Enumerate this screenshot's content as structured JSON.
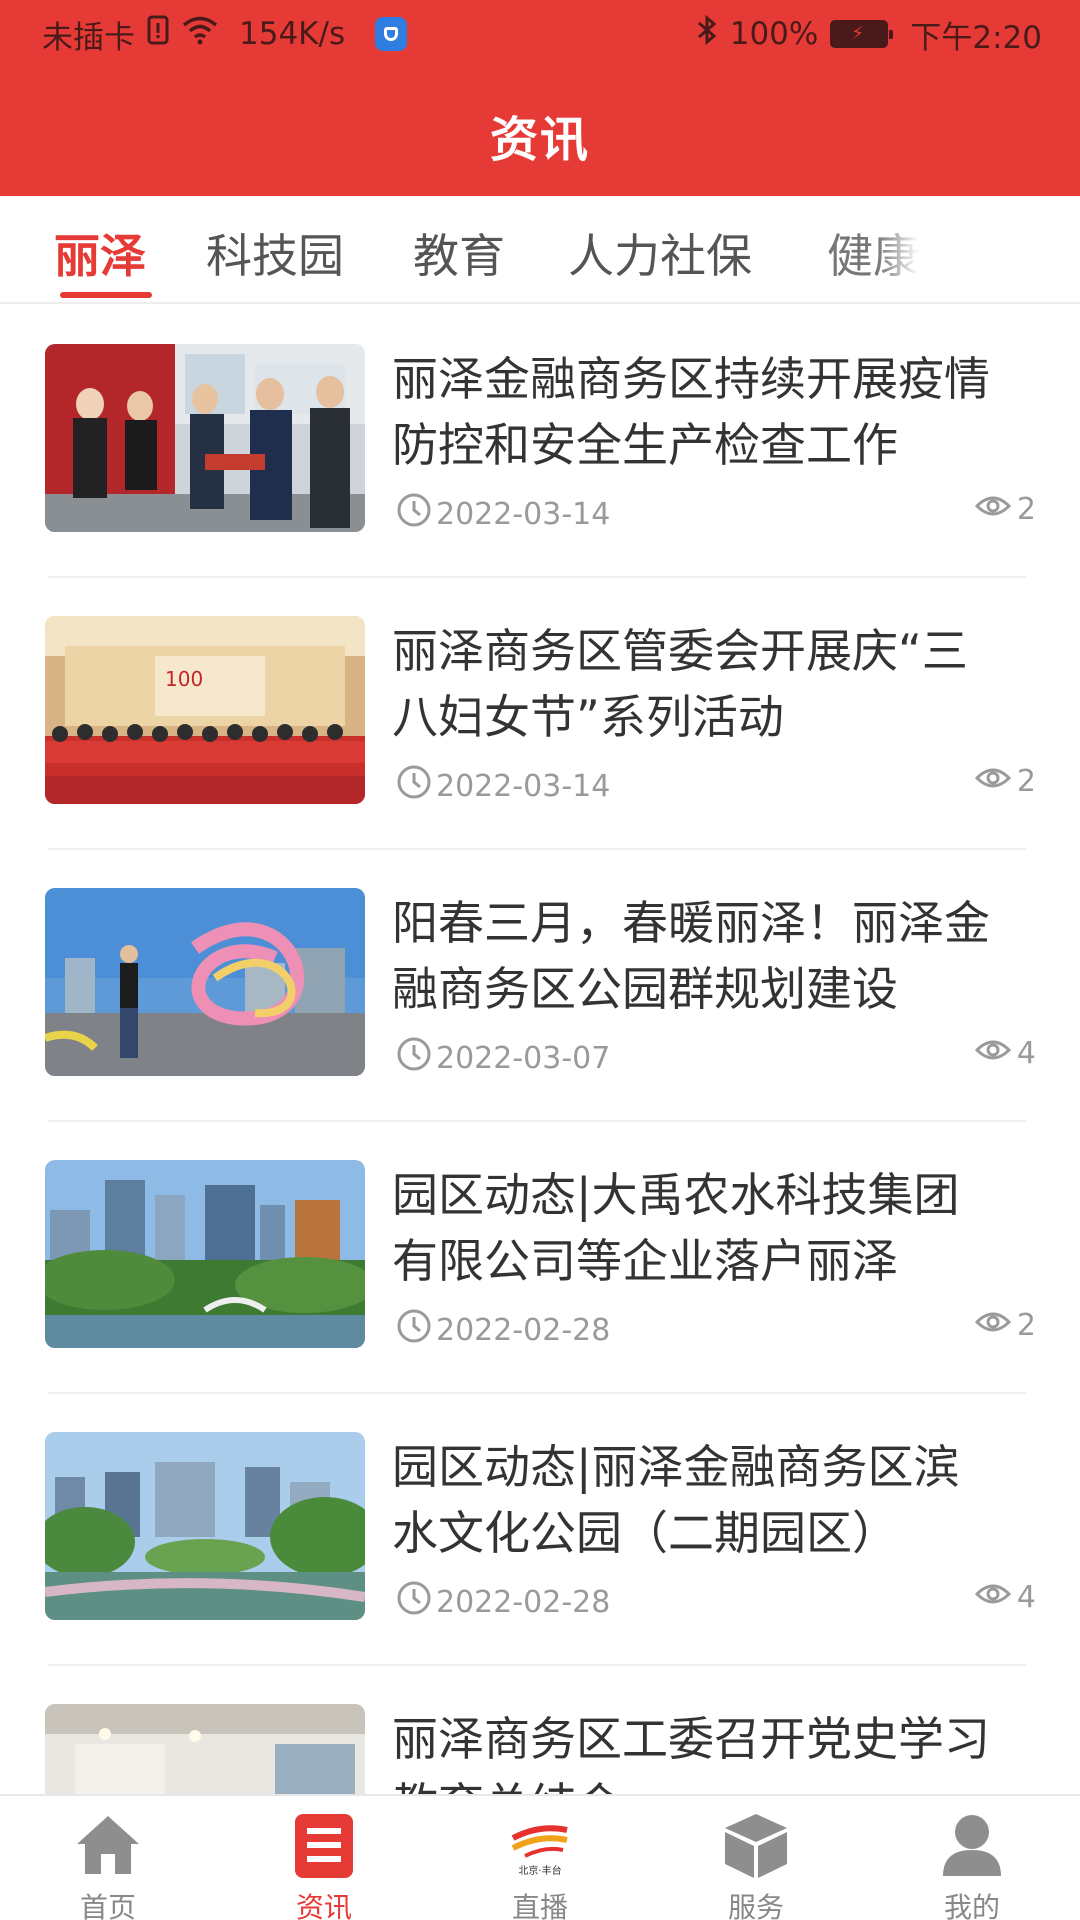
{
  "status_bar": {
    "carrier": "未插卡",
    "speed": "154K/s",
    "battery": "100%",
    "time": "下午2:20"
  },
  "header": {
    "title": "资讯"
  },
  "tabs": [
    {
      "label": "丽泽",
      "active": true
    },
    {
      "label": "科技园",
      "active": false
    },
    {
      "label": "教育",
      "active": false
    },
    {
      "label": "人力社保",
      "active": false
    },
    {
      "label": "健康",
      "active": false
    }
  ],
  "news": [
    {
      "title": "丽泽金融商务区持续开展疫情防控和安全生产检查工作",
      "date": "2022-03-14",
      "views": "2"
    },
    {
      "title": "丽泽商务区管委会开展庆“三八妇女节”系列活动",
      "date": "2022-03-14",
      "views": "2"
    },
    {
      "title": "阳春三月，春暖丽泽！丽泽金融商务区公园群规划建设",
      "date": "2022-03-07",
      "views": "4"
    },
    {
      "title": "园区动态|大禹农水科技集团有限公司等企业落户丽泽",
      "date": "2022-02-28",
      "views": "2"
    },
    {
      "title": "园区动态|丽泽金融商务区滨水文化公园（二期园区）",
      "date": "2022-02-28",
      "views": "4"
    },
    {
      "title": "丽泽商务区工委召开党史学习教育总结会",
      "date": "",
      "views": ""
    }
  ],
  "tabbar": [
    {
      "label": "首页",
      "icon": "home-icon",
      "active": false
    },
    {
      "label": "资讯",
      "icon": "news-icon",
      "active": true
    },
    {
      "label": "直播",
      "icon": "live-logo-icon",
      "logo_text": "北京·丰台",
      "active": false
    },
    {
      "label": "服务",
      "icon": "box-icon",
      "active": false
    },
    {
      "label": "我的",
      "icon": "user-icon",
      "active": false
    }
  ],
  "colors": {
    "brand_red": "#e63a36",
    "meta_gray": "#9a9a9a",
    "tab_gray": "#888888"
  }
}
